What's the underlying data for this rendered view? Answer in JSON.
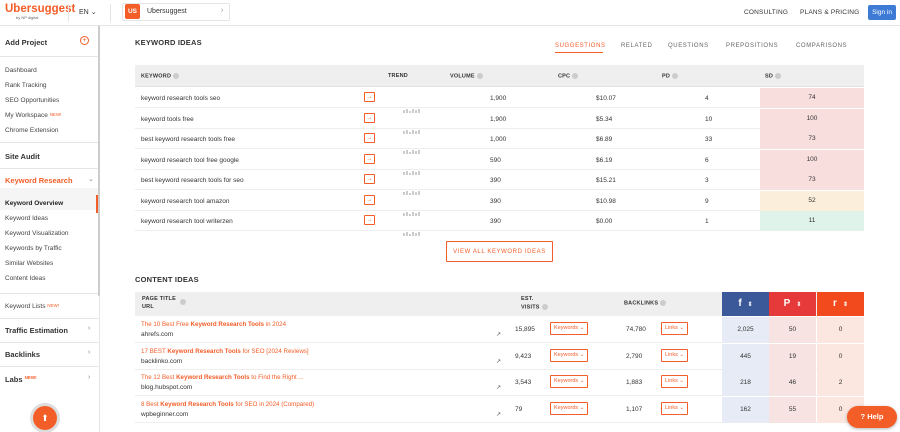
{
  "top": {
    "logo": "Ubersuggest",
    "logo_sub": "by NP digital",
    "lang": "EN",
    "project_badge": "US",
    "project_name": "Ubersuggest",
    "consulting": "CONSULTING",
    "plans": "PLANS & PRICING",
    "signin": "Sign in"
  },
  "sidebar": {
    "add_project": "Add Project",
    "items1": [
      "Dashboard",
      "Rank Tracking",
      "SEO Opportunities",
      "My Workspace",
      "Chrome Extension"
    ],
    "new_badge": "NEW!",
    "site_audit": "Site Audit",
    "keyword_research": "Keyword Research",
    "kr_items": [
      "Keyword Overview",
      "Keyword Ideas",
      "Keyword Visualization",
      "Keywords by Traffic",
      "Similar Websites",
      "Content Ideas"
    ],
    "keyword_lists": "Keyword Lists",
    "traffic_estimation": "Traffic Estimation",
    "backlinks": "Backlinks",
    "labs": "Labs"
  },
  "keyword_ideas": {
    "title": "KEYWORD IDEAS",
    "tabs": [
      "SUGGESTIONS",
      "RELATED",
      "QUESTIONS",
      "PREPOSITIONS",
      "COMPARISONS"
    ],
    "headers": {
      "keyword": "KEYWORD",
      "trend": "TREND",
      "volume": "VOLUME",
      "cpc": "CPC",
      "pd": "PD",
      "sd": "SD"
    },
    "rows": [
      {
        "keyword": "keyword research tools seo",
        "volume": "1,900",
        "cpc": "$10.07",
        "pd": "4",
        "sd": "74",
        "sd_color": "#f9dede"
      },
      {
        "keyword": "keyword tools free",
        "volume": "1,900",
        "cpc": "$5.34",
        "pd": "10",
        "sd": "100",
        "sd_color": "#f9dede"
      },
      {
        "keyword": "best keyword research tools free",
        "volume": "1,000",
        "cpc": "$6.89",
        "pd": "33",
        "sd": "73",
        "sd_color": "#f9dede"
      },
      {
        "keyword": "keyword research tool free google",
        "volume": "590",
        "cpc": "$6.19",
        "pd": "6",
        "sd": "100",
        "sd_color": "#f9dede"
      },
      {
        "keyword": "best keyword research tools for seo",
        "volume": "390",
        "cpc": "$15.21",
        "pd": "3",
        "sd": "73",
        "sd_color": "#f9dede"
      },
      {
        "keyword": "keyword research tool amazon",
        "volume": "390",
        "cpc": "$10.98",
        "pd": "9",
        "sd": "52",
        "sd_color": "#fbeedb"
      },
      {
        "keyword": "keyword research tool writerzen",
        "volume": "390",
        "cpc": "$0.00",
        "pd": "1",
        "sd": "11",
        "sd_color": "#dff3ea"
      }
    ],
    "view_all": "VIEW ALL KEYWORD IDEAS"
  },
  "content_ideas": {
    "title": "CONTENT IDEAS",
    "headers": {
      "page_title": "PAGE TITLE",
      "url": "URL",
      "est": "EST.",
      "visits": "VISITS",
      "backlinks": "BACKLINKS"
    },
    "social": {
      "facebook": "f",
      "pinterest": "P",
      "reddit": "r"
    },
    "social_colors": {
      "facebook": "#3b5998",
      "pinterest": "#e63a3a",
      "reddit": "#f24a1d"
    },
    "rows": [
      {
        "pre": "The 10 Best Free ",
        "bold": "Keyword Research Tools",
        "post": " in 2024",
        "url": "ahrefs.com",
        "visits": "15,895",
        "kw_label": "Keywords",
        "backlinks": "74,780",
        "links_label": "Links",
        "fb": "2,025",
        "pin": "50",
        "red": "0"
      },
      {
        "pre": "17 BEST ",
        "bold": "Keyword Research Tools",
        "post": " for SEO [2024 Reviews]",
        "url": "backlinko.com",
        "visits": "9,423",
        "kw_label": "Keywords",
        "backlinks": "2,790",
        "links_label": "Links",
        "fb": "445",
        "pin": "19",
        "red": "0"
      },
      {
        "pre": "The 12 Best ",
        "bold": "Keyword Research Tools",
        "post": " to Find the Right ...",
        "url": "blog.hubspot.com",
        "visits": "3,543",
        "kw_label": "Keywords",
        "backlinks": "1,883",
        "links_label": "Links",
        "fb": "218",
        "pin": "46",
        "red": "2"
      },
      {
        "pre": "8 Best ",
        "bold": "Keyword Research Tools",
        "post": " for SEO in 2024 (Compared)",
        "url": "wpbeginner.com",
        "visits": "79",
        "kw_label": "Keywords",
        "backlinks": "1,107",
        "links_label": "Links",
        "fb": "162",
        "pin": "55",
        "red": "0"
      }
    ]
  },
  "help": "Help"
}
